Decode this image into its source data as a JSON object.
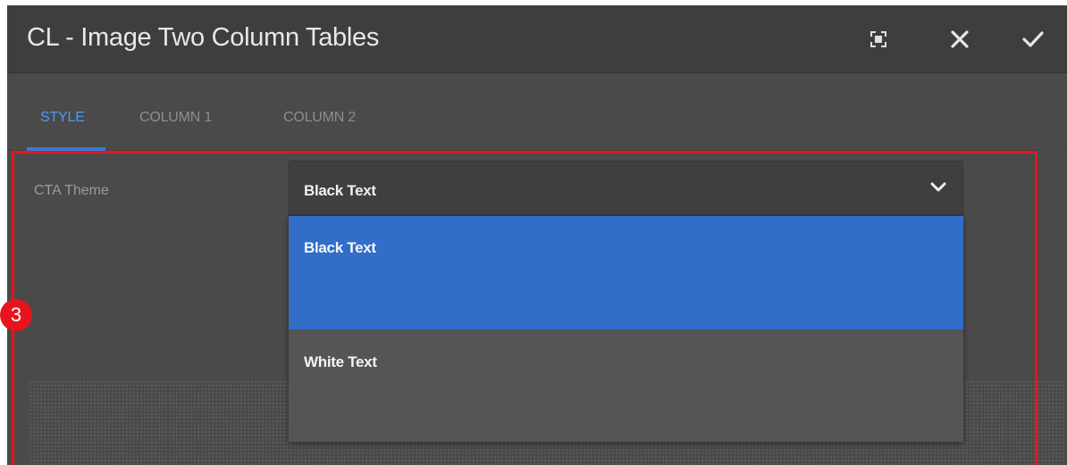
{
  "dialog": {
    "title": "CL - Image Two Column Tables",
    "actions": [
      {
        "icon": "fullscreen-icon"
      },
      {
        "icon": "close-icon"
      },
      {
        "icon": "check-icon"
      }
    ]
  },
  "tabs": [
    {
      "label": "STYLE",
      "active": true
    },
    {
      "label": "COLUMN 1",
      "active": false
    },
    {
      "label": "COLUMN 2",
      "active": false
    }
  ],
  "form": {
    "cta_theme": {
      "label": "CTA Theme",
      "value": "Black Text",
      "icon": "chevron-down-icon",
      "options": [
        {
          "label": "Black Text",
          "selected": true
        },
        {
          "label": "White Text",
          "selected": false
        }
      ]
    }
  },
  "annotation": {
    "step_number": "3",
    "color": "#e8141c"
  },
  "colors": {
    "accent": "#2f7fd8",
    "selected_option": "#326dc8",
    "dialog_bg": "#4a4a4a"
  }
}
